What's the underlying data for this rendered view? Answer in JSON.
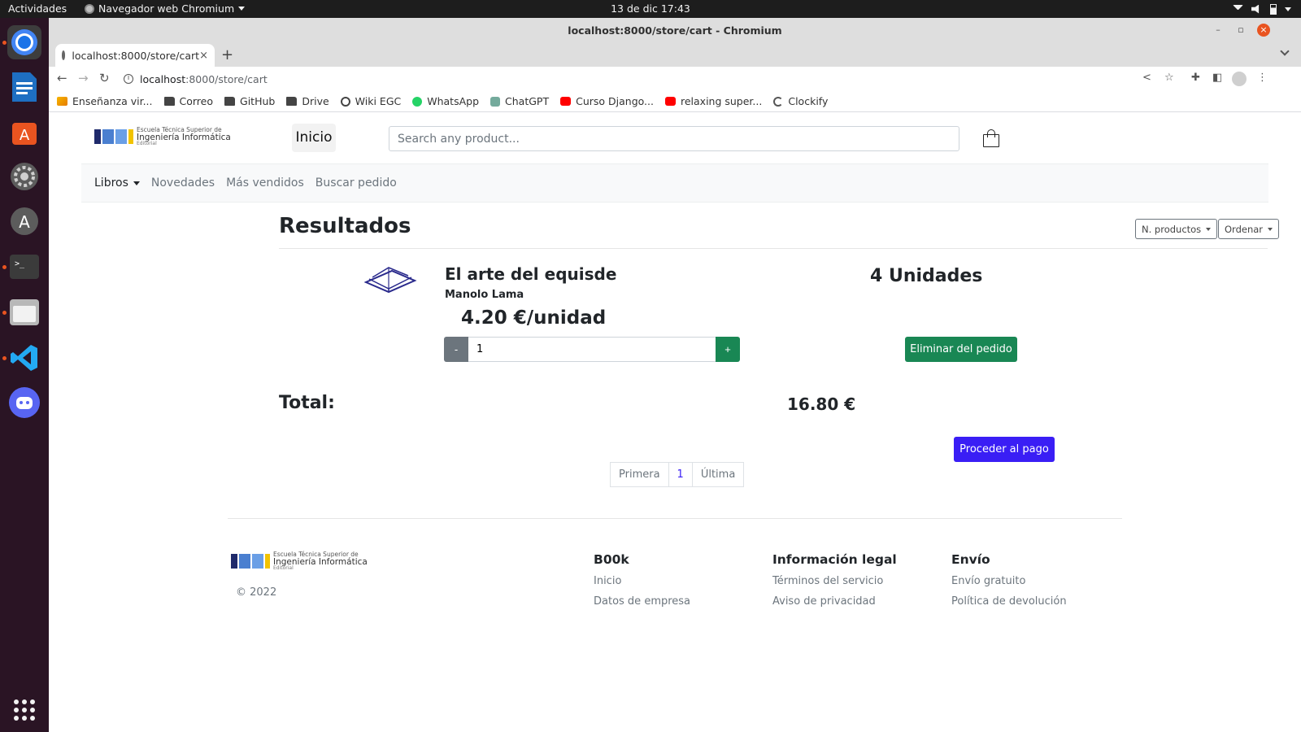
{
  "os": {
    "activities": "Actividades",
    "app_menu": "Navegador web Chromium",
    "clock": "13 de dic  17:43"
  },
  "dock": {
    "items": [
      "chrome-icon",
      "writer-icon",
      "app-center-icon",
      "settings-icon",
      "software-updater-icon",
      "terminal-icon",
      "files-icon",
      "vscode-icon",
      "discord-icon"
    ]
  },
  "window": {
    "title": "localhost:8000/store/cart - Chromium"
  },
  "tab": {
    "label": "localhost:8000/store/cart"
  },
  "address": {
    "host": "localhost",
    "path": ":8000/store/cart"
  },
  "bookmarks": [
    {
      "label": "Enseñanza vir...",
      "icon": "edu-icon"
    },
    {
      "label": "Correo",
      "icon": "folder-icon"
    },
    {
      "label": "GitHub",
      "icon": "folder-icon"
    },
    {
      "label": "Drive",
      "icon": "folder-icon"
    },
    {
      "label": "Wiki EGC",
      "icon": "globe-icon"
    },
    {
      "label": "WhatsApp",
      "icon": "whatsapp-icon"
    },
    {
      "label": "ChatGPT",
      "icon": "chatgpt-icon"
    },
    {
      "label": "Curso Django...",
      "icon": "youtube-icon"
    },
    {
      "label": "relaxing super...",
      "icon": "youtube-icon"
    },
    {
      "label": "Clockify",
      "icon": "clockify-icon"
    }
  ],
  "site": {
    "logo": {
      "line1": "Escuela Técnica Superior de",
      "line2": "Ingeniería Informática",
      "line3": "Editorial"
    },
    "header": {
      "home_button": "Inicio",
      "search_placeholder": "Search any product..."
    },
    "subnav": {
      "books": "Libros",
      "news": "Novedades",
      "bestsellers": "Más vendidos",
      "find_order": "Buscar pedido"
    },
    "results": {
      "title": "Resultados",
      "n_products": "N. productos",
      "sort": "Ordenar"
    },
    "cart_item": {
      "title": "El arte del equisde",
      "author": "Manolo Lama",
      "price": "4.20 €/unidad",
      "quantity_input": "1",
      "minus": "-",
      "plus": "+",
      "units": "4 Unidades",
      "remove": "Eliminar del pedido"
    },
    "total": {
      "label": "Total:",
      "value": "16.80 €"
    },
    "checkout": "Proceder al pago",
    "pagination": {
      "first": "Primera",
      "current": "1",
      "last": "Última"
    },
    "footer": {
      "copyright": "© 2022",
      "col1": {
        "title": "B00k",
        "links": [
          "Inicio",
          "Datos de empresa"
        ]
      },
      "col2": {
        "title": "Información legal",
        "links": [
          "Términos del servicio",
          "Aviso de privacidad"
        ]
      },
      "col3": {
        "title": "Envío",
        "links": [
          "Envío gratuito",
          "Política de devolución"
        ]
      }
    }
  },
  "colors": {
    "primary": "#3a1ef5",
    "success": "#198754",
    "secondary": "#6c757d",
    "ubuntu_orange": "#e95420",
    "logo_navy": "#1f2a6b",
    "logo_blue": "#4a7fd0",
    "logo_yellow": "#f2c300"
  }
}
